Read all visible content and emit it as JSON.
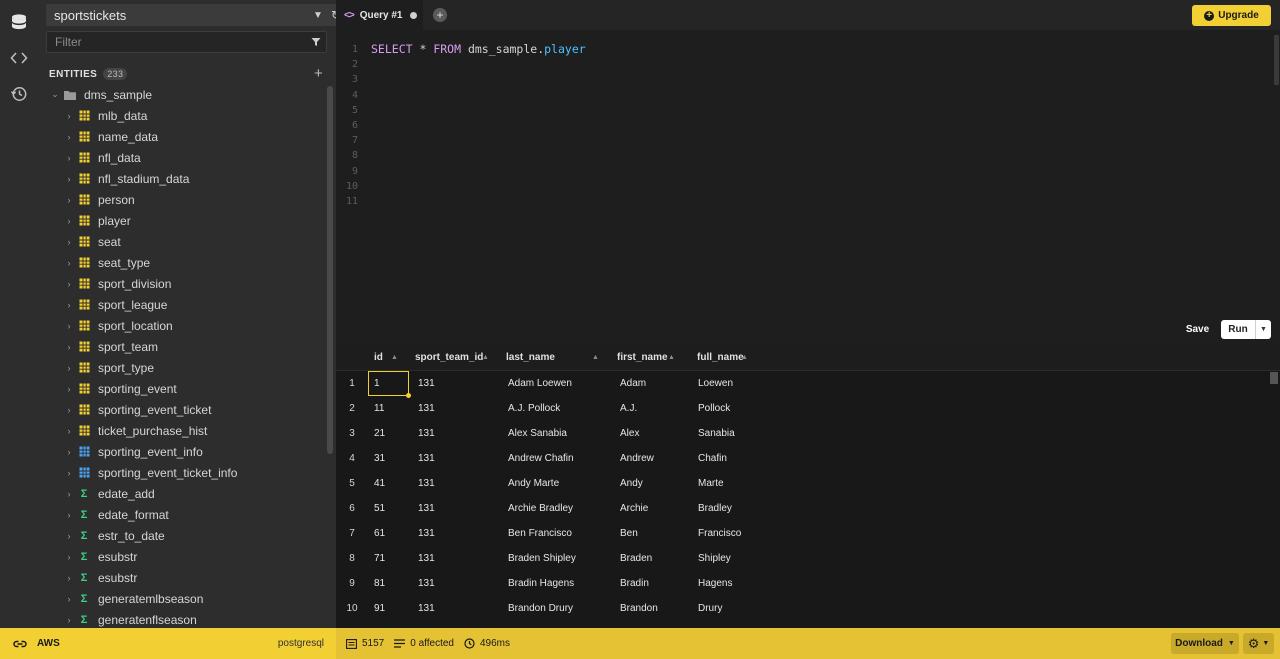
{
  "sidebar": {
    "connection": "sportstickets",
    "filter_placeholder": "Filter",
    "entities_label": "ENTITIES",
    "entities_count": "233",
    "schema": "dms_sample",
    "items": [
      {
        "label": "mlb_data",
        "kind": "table"
      },
      {
        "label": "name_data",
        "kind": "table"
      },
      {
        "label": "nfl_data",
        "kind": "table"
      },
      {
        "label": "nfl_stadium_data",
        "kind": "table"
      },
      {
        "label": "person",
        "kind": "table"
      },
      {
        "label": "player",
        "kind": "table"
      },
      {
        "label": "seat",
        "kind": "table"
      },
      {
        "label": "seat_type",
        "kind": "table"
      },
      {
        "label": "sport_division",
        "kind": "table"
      },
      {
        "label": "sport_league",
        "kind": "table"
      },
      {
        "label": "sport_location",
        "kind": "table"
      },
      {
        "label": "sport_team",
        "kind": "table"
      },
      {
        "label": "sport_type",
        "kind": "table"
      },
      {
        "label": "sporting_event",
        "kind": "table"
      },
      {
        "label": "sporting_event_ticket",
        "kind": "table"
      },
      {
        "label": "ticket_purchase_hist",
        "kind": "table"
      },
      {
        "label": "sporting_event_info",
        "kind": "view"
      },
      {
        "label": "sporting_event_ticket_info",
        "kind": "view"
      },
      {
        "label": "edate_add",
        "kind": "function"
      },
      {
        "label": "edate_format",
        "kind": "function"
      },
      {
        "label": "estr_to_date",
        "kind": "function"
      },
      {
        "label": "esubstr",
        "kind": "function"
      },
      {
        "label": "esubstr",
        "kind": "function"
      },
      {
        "label": "generatemlbseason",
        "kind": "function"
      },
      {
        "label": "generatenflseason",
        "kind": "function"
      }
    ]
  },
  "tabs": [
    {
      "label": "Query #1"
    }
  ],
  "upgrade_label": "Upgrade",
  "editor": {
    "line_numbers": [
      "1",
      "2",
      "3",
      "4",
      "5",
      "6",
      "7",
      "8",
      "9",
      "10",
      "11"
    ],
    "kw1": "SELECT",
    "star": " * ",
    "kw2": "FROM",
    "schema": " dms_sample.",
    "table": "player"
  },
  "actions": {
    "save": "Save",
    "run": "Run"
  },
  "results": {
    "columns": [
      "id",
      "sport_team_id",
      "last_name",
      "first_name",
      "full_name"
    ],
    "rows": [
      [
        "1",
        "1",
        "131",
        "Adam Loewen",
        "Adam",
        "Loewen"
      ],
      [
        "2",
        "11",
        "131",
        "A.J. Pollock",
        "A.J.",
        "Pollock"
      ],
      [
        "3",
        "21",
        "131",
        "Alex Sanabia",
        "Alex",
        "Sanabia"
      ],
      [
        "4",
        "31",
        "131",
        "Andrew Chafin",
        "Andrew",
        "Chafin"
      ],
      [
        "5",
        "41",
        "131",
        "Andy Marte",
        "Andy",
        "Marte"
      ],
      [
        "6",
        "51",
        "131",
        "Archie Bradley",
        "Archie",
        "Bradley"
      ],
      [
        "7",
        "61",
        "131",
        "Ben Francisco",
        "Ben",
        "Francisco"
      ],
      [
        "8",
        "71",
        "131",
        "Braden Shipley",
        "Braden",
        "Shipley"
      ],
      [
        "9",
        "81",
        "131",
        "Bradin Hagens",
        "Bradin",
        "Hagens"
      ],
      [
        "10",
        "91",
        "131",
        "Brandon Drury",
        "Brandon",
        "Drury"
      ]
    ]
  },
  "status": {
    "provider": "AWS",
    "engine": "postgresql",
    "rows": "5157",
    "affected": "0 affected",
    "time": "496ms",
    "download": "Download"
  },
  "colors": {
    "accent": "#f2cf32",
    "keyword": "#d99cf0",
    "table_ident": "#4fc1ff"
  }
}
